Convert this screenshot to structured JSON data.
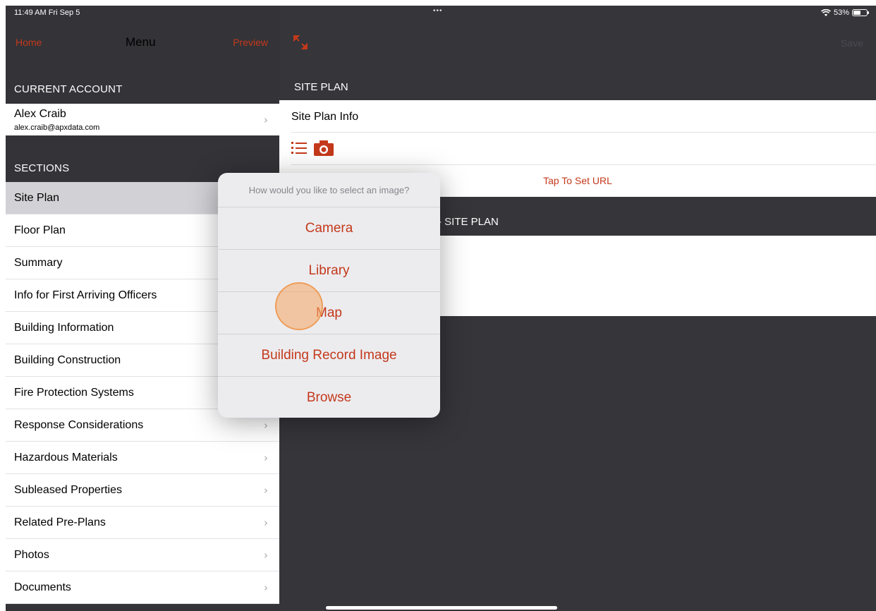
{
  "status_bar": {
    "time": "11:49 AM  Fri Sep 5",
    "dots": "•••",
    "battery_pct": "53%",
    "battery_level": 0.53
  },
  "left_nav": {
    "home": "Home",
    "title": "Menu",
    "preview": "Preview"
  },
  "current_account": {
    "header": "CURRENT ACCOUNT",
    "name": "Alex Craib",
    "email": "alex.craib@apxdata.com"
  },
  "sections": {
    "header": "SECTIONS",
    "items": [
      {
        "label": "Site Plan",
        "selected": true
      },
      {
        "label": "Floor Plan"
      },
      {
        "label": "Summary"
      },
      {
        "label": "Info for First Arriving Officers"
      },
      {
        "label": "Building Information"
      },
      {
        "label": "Building Construction"
      },
      {
        "label": "Fire Protection Systems"
      },
      {
        "label": "Response Considerations"
      },
      {
        "label": "Hazardous Materials"
      },
      {
        "label": "Subleased Properties"
      },
      {
        "label": "Related Pre-Plans"
      },
      {
        "label": "Photos"
      },
      {
        "label": "Documents"
      }
    ]
  },
  "right_nav": {
    "save": "Save"
  },
  "site_plan": {
    "header": "SITE PLAN",
    "info_label": "Site Plan Info",
    "tap_url": "Tap To Set URL",
    "section_header_partial": "N - SITE PLAN"
  },
  "popover": {
    "title": "How would you like to select an image?",
    "options": [
      "Camera",
      "Library",
      "Map",
      "Building Record Image",
      "Browse"
    ]
  },
  "colors": {
    "accent": "#c4391b",
    "dark_bg": "#35353a",
    "selected_row": "#d1d1d6"
  }
}
